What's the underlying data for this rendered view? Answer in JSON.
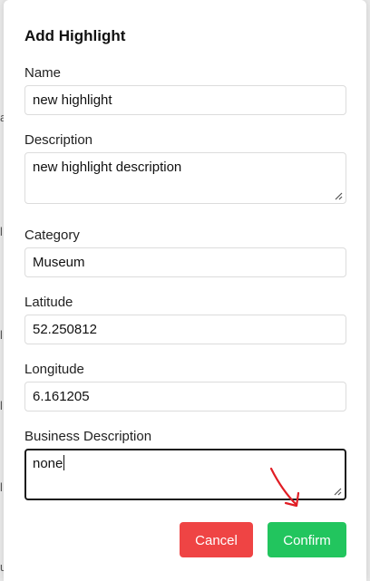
{
  "dialog": {
    "title": "Add Highlight"
  },
  "fields": {
    "name": {
      "label": "Name",
      "value": "new highlight"
    },
    "description": {
      "label": "Description",
      "value": "new highlight description"
    },
    "category": {
      "label": "Category",
      "value": "Museum"
    },
    "latitude": {
      "label": "Latitude",
      "value": "52.250812"
    },
    "longitude": {
      "label": "Longitude",
      "value": "6.161205"
    },
    "business_description": {
      "label": "Business Description",
      "value": "none"
    }
  },
  "actions": {
    "cancel_label": "Cancel",
    "confirm_label": "Confirm"
  },
  "colors": {
    "cancel": "#ef4444",
    "confirm": "#22c55e",
    "annotation_arrow": "#e11d24"
  },
  "icons": {
    "resize_grip": "resize-grip-icon",
    "annotation": "red-arrow-annotation"
  }
}
